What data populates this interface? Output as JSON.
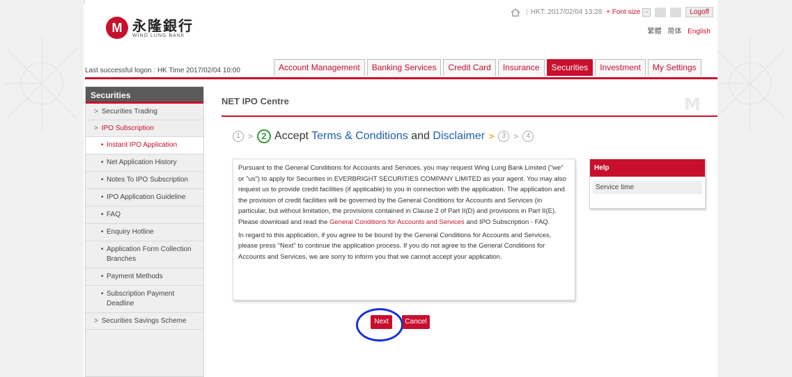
{
  "header": {
    "logo_cn": "永隆銀行",
    "logo_en": "WING LUNG BANK",
    "logo_mark": "M",
    "server_time": "HKT: 2017/02/04 13:28",
    "font_size_label": "+ Font size",
    "font_minus": "-",
    "logoff_label": "Logoff",
    "lang_trad": "繁體",
    "lang_simp": "简体",
    "lang_en": "English",
    "last_logon": "Last successful logon : HK Time 2017/02/04 10:00"
  },
  "nav": {
    "tabs": [
      {
        "label": "Account Management"
      },
      {
        "label": "Banking Services"
      },
      {
        "label": "Credit Card"
      },
      {
        "label": "Insurance"
      },
      {
        "label": "Securities",
        "active": true
      },
      {
        "label": "Investment"
      },
      {
        "label": "My Settings"
      }
    ]
  },
  "sidebar": {
    "title": "Securities",
    "items": {
      "trading": "Securities Trading",
      "ipo": "IPO Subscription",
      "instant": "Instant IPO Application",
      "history": "Net Application History",
      "notes": "Notes To IPO Subscription",
      "guideline": "IPO Application Guideline",
      "faq": "FAQ",
      "enquiry": "Enquiry Hotline",
      "branches": "Application Form Collection Branches",
      "payment": "Payment Methods",
      "deadline": "Subscription Payment Deadline",
      "savings": "Securities Savings Scheme"
    }
  },
  "content": {
    "title": "NET IPO Centre",
    "steps": {
      "s1": "1",
      "s2": "2",
      "s3": "3",
      "s4": "4",
      "label_pre": "Accept ",
      "label_terms": "Terms & Conditions",
      "label_and": " and ",
      "label_disclaimer": "Disclaimer"
    },
    "para1_a": "Pursuant to the General Conditions for Accounts and Services, you may request Wing Lung Bank Limited (\"we\" or \"us\") to apply for Securities in EVERBRIGHT SECURITIES COMPANY LIMITED as your agent. You may also request us to provide credit facilities (if applicable) to you in connection with the application. The application and the provision of credit facilities will be governed by the General Conditions for Accounts and Services (in particular, but without limitation, the provisions contained in Clause 2 of Part II(D) and provisions in Part II(E). Please download and read the ",
    "para1_link": "General Conditions for Accounts and Services",
    "para1_b": " and IPO Subscription - FAQ.",
    "para2": "In regard to this application, if you agree to be bound by the General Conditions for Accounts and Services, please press \"Next\" to continue the application process. If you do not agree to the General Conditions for Accounts and Services, we are sorry to inform you that we cannot accept your application.",
    "next_label": "Next",
    "cancel_label": "Cancel"
  },
  "help": {
    "title": "Help",
    "item": "Service time"
  },
  "colors": {
    "brand_red": "#c8102e",
    "annotation_blue": "#1530d8"
  }
}
